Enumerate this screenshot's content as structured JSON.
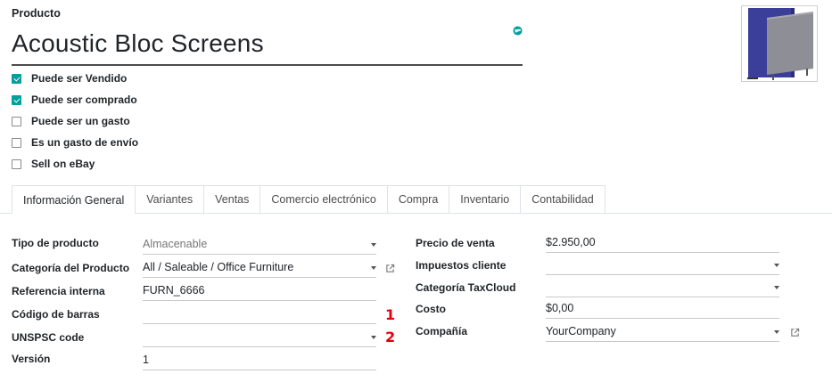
{
  "header": {
    "label": "Producto",
    "name": "Acoustic Bloc Screens"
  },
  "options": [
    {
      "label": "Puede ser Vendido",
      "checked": true
    },
    {
      "label": "Puede ser comprado",
      "checked": true
    },
    {
      "label": "Puede ser un gasto",
      "checked": false
    },
    {
      "label": "Es un gasto de envío",
      "checked": false
    },
    {
      "label": "Sell on eBay",
      "checked": false
    }
  ],
  "tabs": [
    {
      "label": "Información General",
      "active": true
    },
    {
      "label": "Variantes"
    },
    {
      "label": "Ventas"
    },
    {
      "label": "Comercio electrónico"
    },
    {
      "label": "Compra"
    },
    {
      "label": "Inventario"
    },
    {
      "label": "Contabilidad"
    }
  ],
  "left_fields": {
    "product_type": {
      "label": "Tipo de producto",
      "value": "Almacenable"
    },
    "category": {
      "label": "Categoría del Producto",
      "value": "All / Saleable / Office Furniture"
    },
    "internal_ref": {
      "label": "Referencia interna",
      "value": "FURN_6666"
    },
    "barcode": {
      "label": "Código de barras",
      "value": ""
    },
    "unspsc": {
      "label": "UNSPSC code",
      "value": ""
    },
    "version": {
      "label": "Versión",
      "value": "1"
    }
  },
  "right_fields": {
    "sale_price": {
      "label": "Precio de venta",
      "value": "$2.950,00"
    },
    "customer_taxes": {
      "label": "Impuestos cliente",
      "value": ""
    },
    "taxcloud_category": {
      "label": "Categoría TaxCloud",
      "value": ""
    },
    "cost": {
      "label": "Costo",
      "value": "$0,00"
    },
    "company": {
      "label": "Compañía",
      "value": "YourCompany"
    }
  },
  "annotations": [
    "1",
    "2"
  ],
  "colors": {
    "accent": "#00a09d",
    "annotation": "#e4000f",
    "panel_blue": "#3b3f9a",
    "panel_grey": "#8e8e96"
  }
}
